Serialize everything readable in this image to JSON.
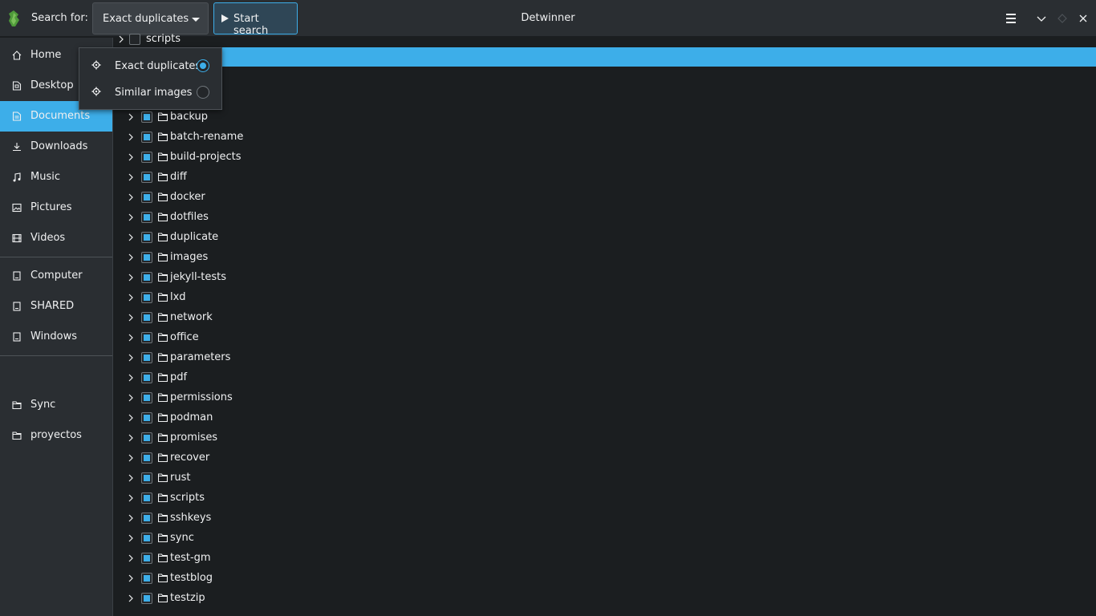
{
  "header": {
    "search_label": "Search for:",
    "mode_value": "Exact duplicates",
    "start_label": "Start search",
    "title": "Detwinner"
  },
  "sidebar": {
    "places": [
      {
        "label": "Home",
        "icon": "home-icon"
      },
      {
        "label": "Desktop",
        "icon": "desktop-icon"
      },
      {
        "label": "Documents",
        "icon": "documents-icon"
      },
      {
        "label": "Downloads",
        "icon": "downloads-icon"
      },
      {
        "label": "Music",
        "icon": "music-icon"
      },
      {
        "label": "Pictures",
        "icon": "pictures-icon"
      },
      {
        "label": "Videos",
        "icon": "videos-icon"
      }
    ],
    "devices": [
      {
        "label": "Computer",
        "icon": "drive-icon"
      },
      {
        "label": "SHARED",
        "icon": "drive-icon"
      },
      {
        "label": "Windows",
        "icon": "drive-icon"
      }
    ],
    "bookmarks": [
      {
        "label": "Sync",
        "icon": "folder-icon"
      },
      {
        "label": "proyectos",
        "icon": "folder-icon"
      }
    ],
    "active": "Documents"
  },
  "tree": {
    "partial_top_label": "scripts",
    "folders": [
      "backup",
      "batch-rename",
      "build-projects",
      "diff",
      "docker",
      "dotfiles",
      "duplicate",
      "images",
      "jekyll-tests",
      "lxd",
      "network",
      "office",
      "parameters",
      "pdf",
      "permissions",
      "podman",
      "promises",
      "recover",
      "rust",
      "scripts",
      "sshkeys",
      "sync",
      "test-gm",
      "testblog",
      "testzip"
    ]
  },
  "popup": {
    "options": [
      {
        "label": "Exact duplicates",
        "selected": true
      },
      {
        "label": "Similar images",
        "selected": false
      }
    ]
  },
  "colors": {
    "accent": "#3daee9",
    "background": "#1b1e20",
    "panel": "#2a2e32"
  }
}
